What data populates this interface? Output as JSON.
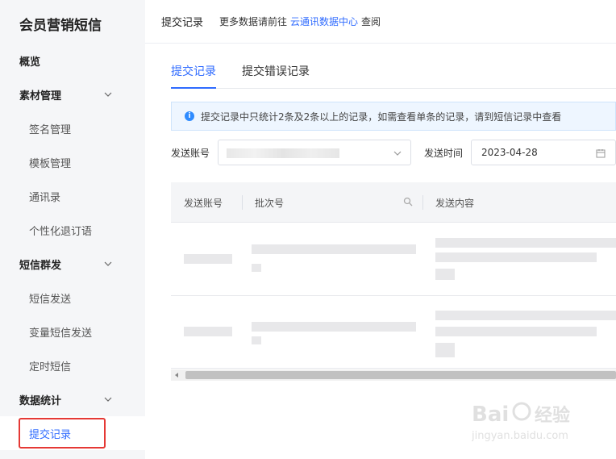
{
  "app": {
    "title": "会员营销短信"
  },
  "sidebar": {
    "items": [
      {
        "label": "概览",
        "type": "section"
      },
      {
        "label": "素材管理",
        "type": "section"
      },
      {
        "label": "签名管理",
        "type": "sub"
      },
      {
        "label": "模板管理",
        "type": "sub"
      },
      {
        "label": "通讯录",
        "type": "sub"
      },
      {
        "label": "个性化退订语",
        "type": "sub"
      },
      {
        "label": "短信群发",
        "type": "section"
      },
      {
        "label": "短信发送",
        "type": "sub"
      },
      {
        "label": "变量短信发送",
        "type": "sub"
      },
      {
        "label": "定时短信",
        "type": "sub"
      },
      {
        "label": "数据统计",
        "type": "section"
      },
      {
        "label": "提交记录",
        "type": "sub",
        "active": true
      }
    ]
  },
  "header": {
    "title": "提交记录",
    "more_prefix": "更多数据请前往",
    "link": "云通讯数据中心",
    "suffix": "查阅"
  },
  "tabs": [
    {
      "label": "提交记录",
      "active": true
    },
    {
      "label": "提交错误记录",
      "active": false
    }
  ],
  "banner": {
    "icon": "i",
    "text": "提交记录中只统计2条及2条以上的记录，如需查看单条的记录，请到短信记录中查看"
  },
  "filters": {
    "account_label": "发送账号",
    "time_label": "发送时间",
    "date_value": "2023-04-28"
  },
  "table": {
    "columns": [
      "发送账号",
      "批次号",
      "发送内容"
    ]
  },
  "watermark": {
    "main": "Bai 经验",
    "sub": "jingyan.baidu.com"
  },
  "colors": {
    "accent": "#2f6bff",
    "highlight": "#e53935"
  }
}
